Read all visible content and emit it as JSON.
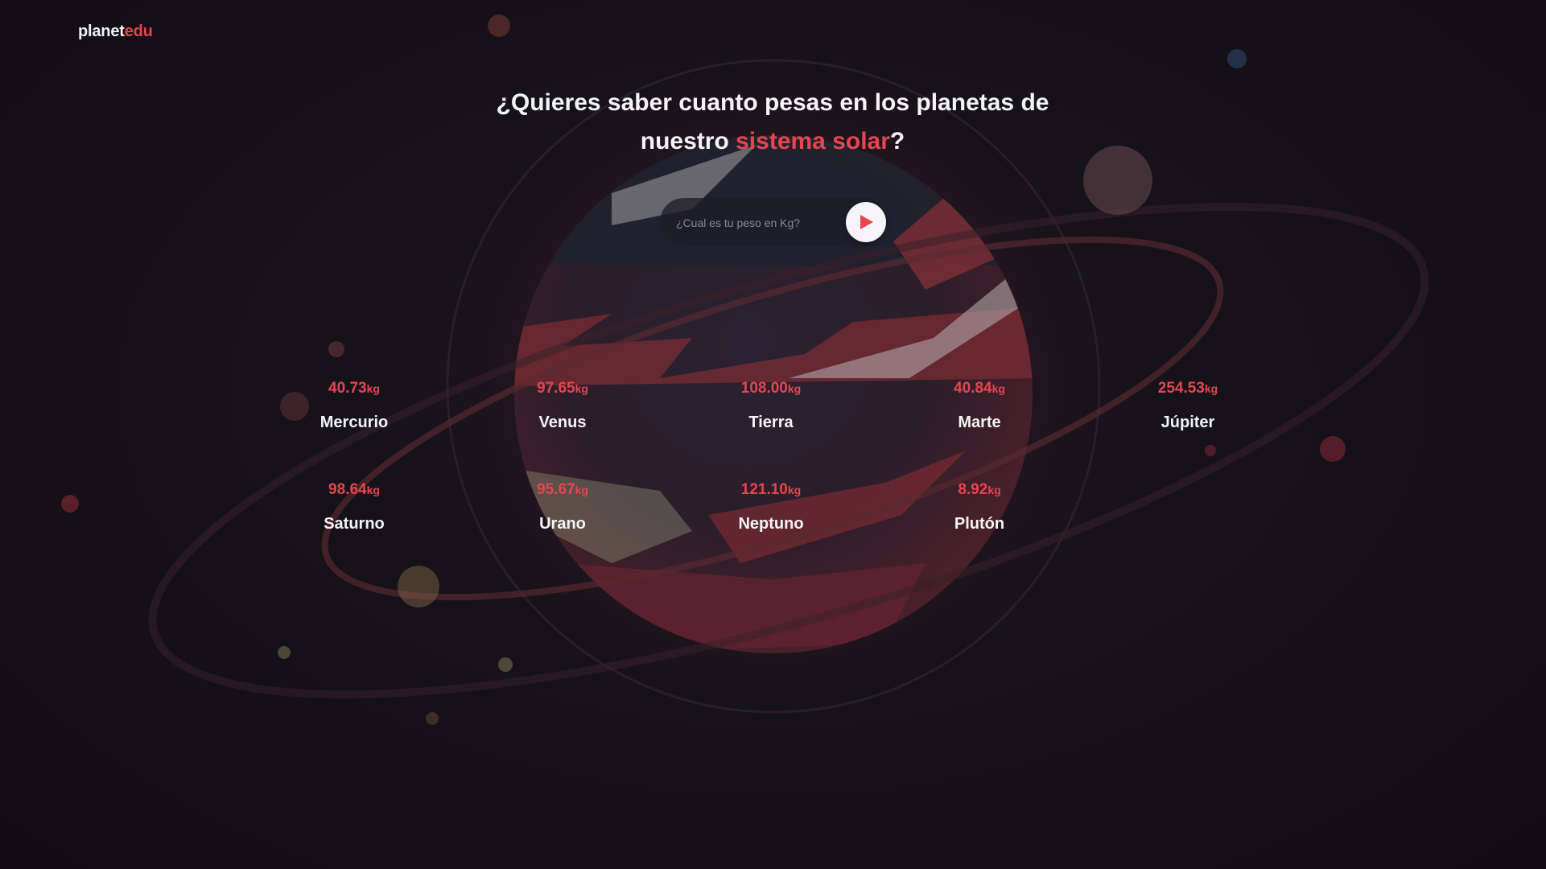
{
  "brand": {
    "primary": "planet",
    "accent": "edu"
  },
  "headline": {
    "line1": "¿Quieres saber cuanto pesas en los planetas de",
    "line2_prefix": "nuestro ",
    "line2_highlight": "sistema solar",
    "line2_suffix": "?"
  },
  "form": {
    "placeholder": "¿Cual es tu peso en Kg?",
    "submit_icon": "play-icon"
  },
  "unit": "kg",
  "results": [
    {
      "planet": "Mercurio",
      "weight": "40.73"
    },
    {
      "planet": "Venus",
      "weight": "97.65"
    },
    {
      "planet": "Tierra",
      "weight": "108.00"
    },
    {
      "planet": "Marte",
      "weight": "40.84"
    },
    {
      "planet": "Júpiter",
      "weight": "254.53"
    },
    {
      "planet": "Saturno",
      "weight": "98.64"
    },
    {
      "planet": "Urano",
      "weight": "95.67"
    },
    {
      "planet": "Neptuno",
      "weight": "121.10"
    },
    {
      "planet": "Plutón",
      "weight": "8.92"
    }
  ],
  "colors": {
    "background": "#131017",
    "accent": "#e8454f",
    "text": "#f4f4f4"
  }
}
